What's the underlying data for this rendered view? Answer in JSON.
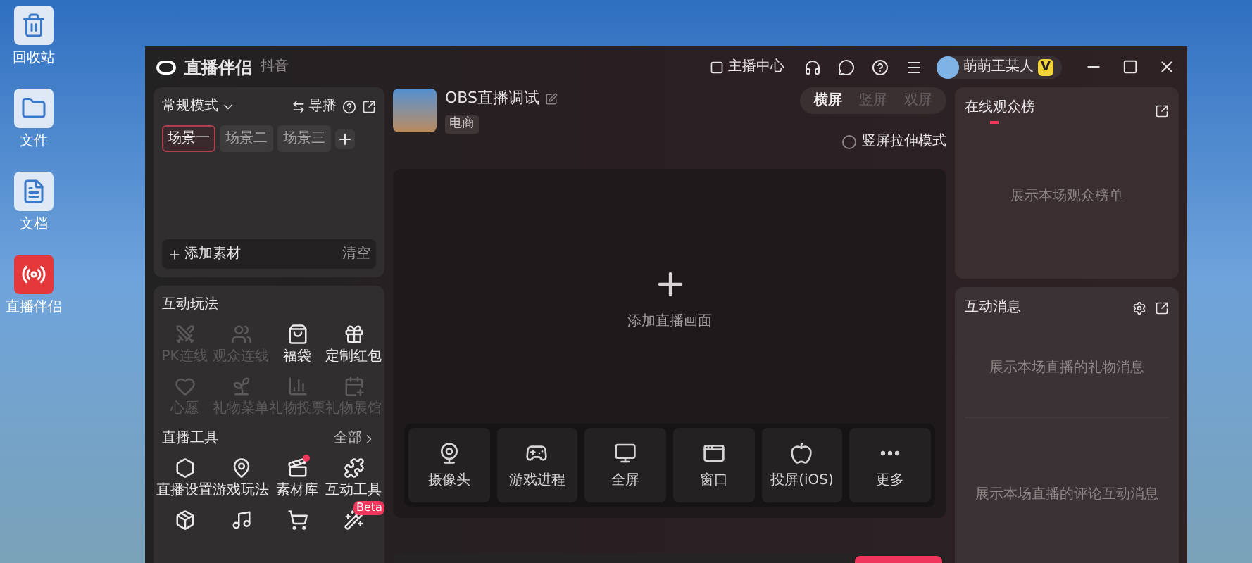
{
  "desktop_icons": [
    {
      "kind": "recycle",
      "label": "回收站"
    },
    {
      "kind": "folder",
      "label": "文件"
    },
    {
      "kind": "document",
      "label": "文档"
    },
    {
      "kind": "app",
      "label": "直播伴侣"
    }
  ],
  "window": {
    "title": "直播伴侣",
    "subtitle": "抖音"
  },
  "header": {
    "anchor_center": "主播中心",
    "user_name": "萌萌王某人",
    "user_badge": "V"
  },
  "scenes": {
    "mode": "常规模式",
    "guide": "导播",
    "tabs": [
      {
        "label": "场景一",
        "selected": true
      },
      {
        "label": "场景二",
        "selected": false
      },
      {
        "label": "场景三",
        "selected": false
      }
    ],
    "add_material": "添加素材",
    "clear": "清空"
  },
  "interaction": {
    "title": "互动玩法",
    "items": [
      {
        "kind": "pk",
        "label": "PK连线",
        "disabled": true
      },
      {
        "kind": "link",
        "label": "观众连线",
        "disabled": true
      },
      {
        "kind": "bag",
        "label": "福袋",
        "disabled": false
      },
      {
        "kind": "redpacket",
        "label": "定制红包",
        "disabled": false
      },
      {
        "kind": "wish",
        "label": "心愿",
        "disabled": true
      },
      {
        "kind": "gift",
        "label": "礼物菜单",
        "disabled": true
      },
      {
        "kind": "bars",
        "label": "礼物投票",
        "disabled": true
      },
      {
        "kind": "calendar",
        "label": "礼物展馆",
        "disabled": true
      }
    ]
  },
  "tools": {
    "title": "直播工具",
    "more": "全部",
    "items": [
      {
        "kind": "settings",
        "label": "直播设置",
        "dot": false
      },
      {
        "kind": "game",
        "label": "游戏玩法",
        "dot": false
      },
      {
        "kind": "media",
        "label": "素材库",
        "dot": true
      },
      {
        "kind": "puzzle",
        "label": "互动工具",
        "dot": false
      }
    ],
    "partial_row": [
      {
        "kind": "box"
      },
      {
        "kind": "note"
      },
      {
        "kind": "cart"
      },
      {
        "kind": "wand",
        "badge": "Beta"
      }
    ]
  },
  "stream": {
    "title": "OBS直播调试",
    "tag": "电商",
    "orientations": [
      {
        "label": "横屏",
        "selected": true
      },
      {
        "label": "竖屏",
        "selected": false
      },
      {
        "label": "双屏",
        "selected": false
      }
    ],
    "stretch_mode": {
      "label": "竖屏拉伸模式",
      "checked": false
    },
    "add_label": "添加直播画面",
    "sources": [
      {
        "kind": "webcam",
        "label": "摄像头"
      },
      {
        "kind": "game",
        "label": "游戏进程"
      },
      {
        "kind": "monitor",
        "label": "全屏"
      },
      {
        "kind": "window",
        "label": "窗口"
      },
      {
        "kind": "apple",
        "label": "投屏(iOS)"
      },
      {
        "kind": "more",
        "label": "更多"
      }
    ]
  },
  "audience": {
    "title": "在线观众榜",
    "empty": "展示本场观众榜单"
  },
  "messages": {
    "title": "互动消息",
    "gift_empty": "展示本场直播的礼物消息",
    "comment_empty": "展示本场直播的评论互动消息"
  }
}
